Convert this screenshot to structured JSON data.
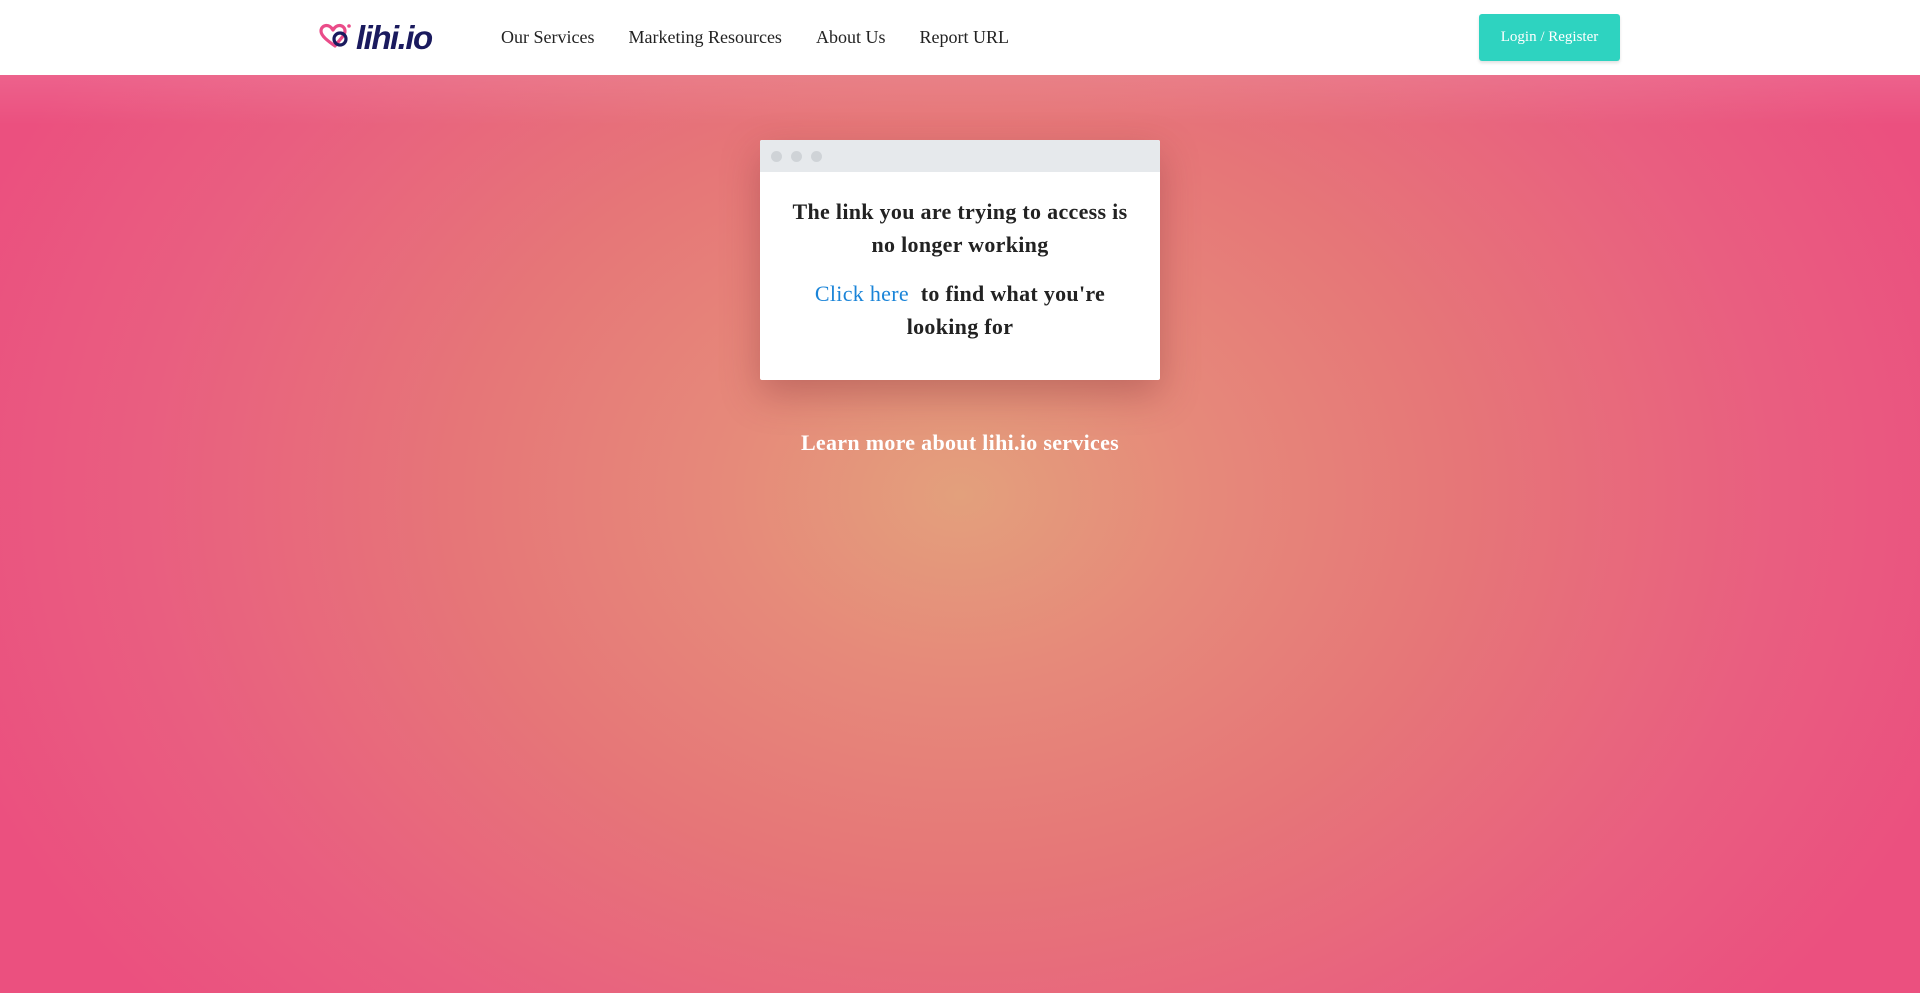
{
  "header": {
    "logo_text": "lihi.io",
    "nav": [
      {
        "label": "Our Services"
      },
      {
        "label": "Marketing Resources"
      },
      {
        "label": "About Us"
      },
      {
        "label": "Report URL"
      }
    ],
    "login_label": "Login / Register"
  },
  "card": {
    "title": "The link you are trying to access is no longer working",
    "link_label": "Click here",
    "line_rest": "to find what you're looking for"
  },
  "learn_more": "Learn more about lihi.io services",
  "colors": {
    "brand_navy": "#1a1a5e",
    "brand_pink": "#ea4c89",
    "login_button": "#2ed3c0",
    "link_blue": "#1a84d8"
  },
  "icons": {
    "logo_mark": "heart-link-icon",
    "window_dots": "window-dot-icon"
  }
}
